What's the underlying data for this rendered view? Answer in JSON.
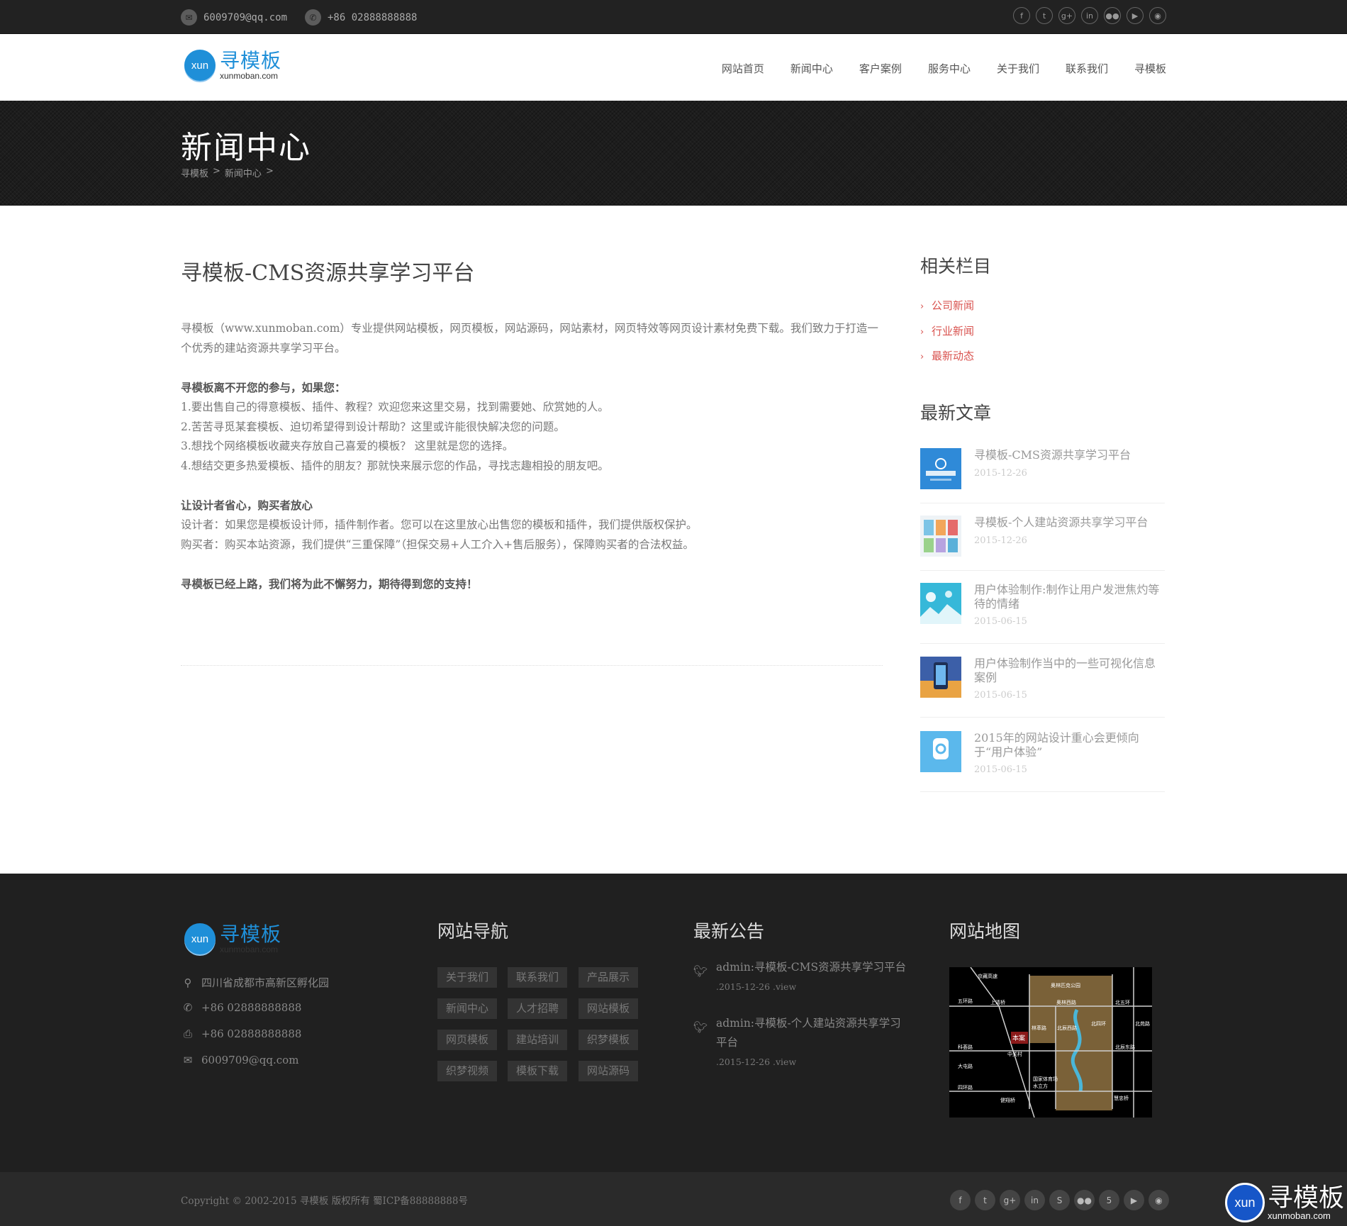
{
  "topbar": {
    "email": "6009709@qq.com",
    "phone": "+86 02888888888",
    "social_icons": [
      "facebook-icon",
      "twitter-icon",
      "google-plus-icon",
      "linkedin-icon",
      "flickr-icon",
      "youtube-icon",
      "rss-icon"
    ]
  },
  "brand": {
    "name": "寻模板",
    "domain": "xunmoban.com",
    "mark": "xun",
    "color": "#1f8fd8"
  },
  "nav": [
    "网站首页",
    "新闻中心",
    "客户案例",
    "服务中心",
    "关于我们",
    "联系我们",
    "寻模板"
  ],
  "banner": {
    "title": "新闻中心",
    "breadcrumb": [
      "寻模板",
      "新闻中心"
    ],
    "separator": ">"
  },
  "article": {
    "title": "寻模板-CMS资源共享学习平台",
    "intro": "寻模板（www.xunmoban.com）专业提供网站模板，网页模板，网站源码，网站素材，网页特效等网页设计素材免费下载。我们致力于打造一个优秀的建站资源共享学习平台。",
    "section1_heading": "寻模板离不开您的参与，如果您：",
    "section1_items": [
      "1.要出售自己的得意模板、插件、教程？欢迎您来这里交易，找到需要她、欣赏她的人。",
      "2.苦苦寻觅某套模板、迫切希望得到设计帮助？这里或许能很快解决您的问题。",
      "3.想找个网络模板收藏夹存放自己喜爱的模板？ 这里就是您的选择。",
      "4.想结交更多热爱模板、插件的朋友？那就快来展示您的作品，寻找志趣相投的朋友吧。"
    ],
    "section2_heading": "让设计者省心，购买者放心",
    "section2_items": [
      "设计者：如果您是模板设计师，插件制作者。您可以在这里放心出售您的模板和插件，我们提供版权保护。",
      "购买者：购买本站资源，我们提供“三重保障”（担保交易+人工介入+售后服务），保障购买者的合法权益。"
    ],
    "closing": "寻模板已经上路，我们将为此不懈努力，期待得到您的支持！"
  },
  "sidebar": {
    "categories_title": "相关栏目",
    "categories": [
      "公司新闻",
      "行业新闻",
      "最新动态"
    ],
    "latest_title": "最新文章",
    "posts": [
      {
        "title": "寻模板-CMS资源共享学习平台",
        "date": "2015-12-26"
      },
      {
        "title": "寻模板-个人建站资源共享学习平台",
        "date": "2015-12-26"
      },
      {
        "title": "用户体验制作:制作让用户发泄焦灼等待的情绪",
        "date": "2015-06-15"
      },
      {
        "title": "用户体验制作当中的一些可视化信息案例",
        "date": "2015-06-15"
      },
      {
        "title": "2015年的网站设计重心会更倾向于“用户体验”",
        "date": "2015-06-15"
      }
    ]
  },
  "footer": {
    "address": "四川省成都市高新区孵化园",
    "phone": "+86 02888888888",
    "fax": "+86 02888888888",
    "email": "6009709@qq.com",
    "nav_title": "网站导航",
    "nav_tags": [
      "关于我们",
      "联系我们",
      "产品展示",
      "新闻中心",
      "人才招聘",
      "网站模板",
      "网页模板",
      "建站培训",
      "织梦模板",
      "织梦视频",
      "模板下载",
      "网站源码"
    ],
    "notice_title": "最新公告",
    "notices": [
      {
        "title": "admin:寻模板-CMS资源共享学习平台",
        "date": ".2015-12-26 .view"
      },
      {
        "title": "admin:寻模板-个人建站资源共享学习平台",
        "date": ".2015-12-26 .view"
      }
    ],
    "map_title": "网站地图",
    "map_labels": [
      "奥林匹克公园",
      "五环路",
      "上清桥",
      "林萃路",
      "奥林西路",
      "北辰西路",
      "北五环",
      "北苑路",
      "北四环",
      "科荟路",
      "大屯路",
      "四环路",
      "健翔桥",
      "中关村",
      "国家体育场",
      "水立方",
      "本案",
      "慧忠桥",
      "北辰东路",
      "京藏高速"
    ]
  },
  "bottom": {
    "copyright": "Copyright © 2002-2015 寻模板 版权所有  蜀ICP备88888888号",
    "social_icons": [
      "facebook-icon",
      "twitter-icon",
      "google-plus-icon",
      "linkedin-icon",
      "skype-icon",
      "flickr-icon",
      "html5-icon",
      "youtube-icon",
      "rss-icon"
    ]
  },
  "watermark": {
    "mark": "xun",
    "name": "寻模板",
    "domain": "xunmoban.com"
  }
}
